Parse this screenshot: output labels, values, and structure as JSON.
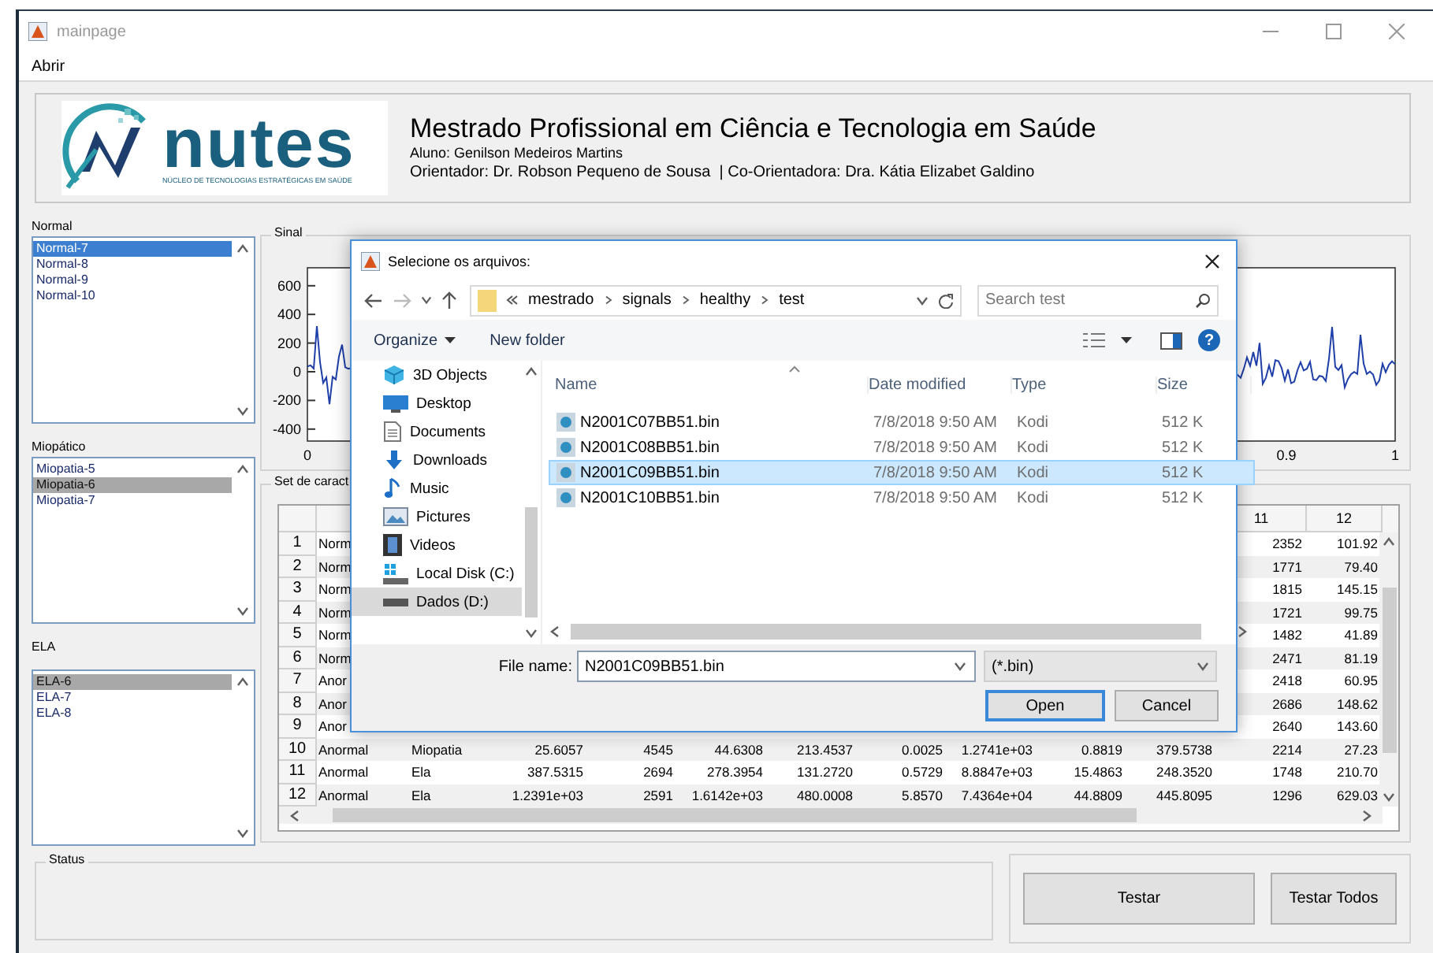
{
  "window": {
    "title": "mainpage"
  },
  "menu": [
    "Abrir"
  ],
  "header": {
    "logo": {
      "wordmark": "nutes",
      "tagline": "NÚCLEO DE TECNOLOGIAS ESTRATÉGICAS EM SAÚDE"
    },
    "title": "Mestrado Profissional em Ciência e Tecnologia em Saúde",
    "student": "Aluno: Genilson Medeiros Martins",
    "advisors": "Orientador: Dr. Robson Pequeno de Sousa  | Co-Orientadora: Dra. Kátia Elizabet Galdino"
  },
  "lists": [
    {
      "label": "Normal",
      "focused": true,
      "items": [
        {
          "text": "Normal-7",
          "selected": true
        },
        {
          "text": "Normal-8",
          "selected": false
        },
        {
          "text": "Normal-9",
          "selected": false
        },
        {
          "text": "Normal-10",
          "selected": false
        }
      ]
    },
    {
      "label": "Miopático",
      "focused": false,
      "items": [
        {
          "text": "Miopatia-5",
          "selected": false
        },
        {
          "text": "Miopatia-6",
          "selected": true
        },
        {
          "text": "Miopatia-7",
          "selected": false
        }
      ]
    },
    {
      "label": "ELA",
      "focused": false,
      "items": [
        {
          "text": "ELA-6",
          "selected": true
        },
        {
          "text": "ELA-7",
          "selected": false
        },
        {
          "text": "ELA-8",
          "selected": false
        }
      ]
    }
  ],
  "signal_panel": {
    "title": "Sinal",
    "y_ticks": [
      "600",
      "400",
      "200",
      "0",
      "-200",
      "-400"
    ],
    "x_ticks": [
      "0",
      "0.9",
      "1"
    ]
  },
  "features_panel": {
    "title": "Set de caract",
    "columns": [
      "11",
      "12"
    ],
    "rows": [
      {
        "number": "1",
        "group": "Norm",
        "col_11": "2352",
        "col_12": "101.92"
      },
      {
        "number": "2",
        "group": "Norm",
        "col_11": "1771",
        "col_12": "79.40"
      },
      {
        "number": "3",
        "group": "Norm",
        "col_11": "1815",
        "col_12": "145.15"
      },
      {
        "number": "4",
        "group": "Norm",
        "col_11": "1721",
        "col_12": "99.75"
      },
      {
        "number": "5",
        "group": "Norm",
        "col_11": "1482",
        "col_12": "41.89"
      },
      {
        "number": "6",
        "group": "Norm",
        "col_11": "2471",
        "col_12": "81.19"
      },
      {
        "number": "7",
        "group": "Anor",
        "col_11": "2418",
        "col_12": "60.95"
      },
      {
        "number": "8",
        "group": "Anor",
        "col_11": "2686",
        "col_12": "148.62"
      },
      {
        "number": "9",
        "group": "Anor",
        "col_11": "2640",
        "col_12": "143.60"
      },
      {
        "number": "10",
        "group": "Anormal",
        "values": [
          "Miopatia",
          "25.6057",
          "4545",
          "44.6308",
          "213.4537",
          "0.0025",
          "1.2741e+03",
          "0.8819",
          "379.5738"
        ],
        "col_11": "2214",
        "col_12": "27.23"
      },
      {
        "number": "11",
        "group": "Anormal",
        "values": [
          "Ela",
          "387.5315",
          "2694",
          "278.3954",
          "131.2720",
          "0.5729",
          "8.8847e+03",
          "15.4863",
          "248.3520"
        ],
        "col_11": "1748",
        "col_12": "210.70"
      },
      {
        "number": "12",
        "group": "Anormal",
        "values": [
          "Ela",
          "1.2391e+03",
          "2591",
          "1.6142e+03",
          "480.0008",
          "5.8570",
          "7.4364e+04",
          "44.8809",
          "445.8095"
        ],
        "col_11": "1296",
        "col_12": "629.03"
      }
    ]
  },
  "status_panel": {
    "title": "Status"
  },
  "buttons": [
    {
      "label": "Testar"
    },
    {
      "label": "Testar Todos"
    }
  ],
  "dialog": {
    "title": "Selecione os arquivos:",
    "path": [
      "mestrado",
      "signals",
      "healthy",
      "test"
    ],
    "search": {
      "placeholder": "Search test"
    },
    "toolbar": [
      "Organize",
      "New folder"
    ],
    "help": "?",
    "nav": [
      {
        "text": "3D Objects",
        "kind": "objects",
        "selected": false
      },
      {
        "text": "Desktop",
        "kind": "desktop",
        "selected": false
      },
      {
        "text": "Documents",
        "kind": "documents",
        "selected": false
      },
      {
        "text": "Downloads",
        "kind": "downloads",
        "selected": false
      },
      {
        "text": "Music",
        "kind": "music",
        "selected": false
      },
      {
        "text": "Pictures",
        "kind": "pictures",
        "selected": false
      },
      {
        "text": "Videos",
        "kind": "videos",
        "selected": false
      },
      {
        "text": "Local Disk (C:)",
        "kind": "disk",
        "selected": false
      },
      {
        "text": "Dados (D:)",
        "kind": "drive",
        "selected": true
      }
    ],
    "columns": [
      "Name",
      "Date modified",
      "Type",
      "Size"
    ],
    "files": [
      {
        "name": "N2001C07BB51.bin",
        "date": "7/8/2018 9:50 AM",
        "type": "Kodi",
        "size": "512 K",
        "selected": false
      },
      {
        "name": "N2001C08BB51.bin",
        "date": "7/8/2018 9:50 AM",
        "type": "Kodi",
        "size": "512 K",
        "selected": false
      },
      {
        "name": "N2001C09BB51.bin",
        "date": "7/8/2018 9:50 AM",
        "type": "Kodi",
        "size": "512 K",
        "selected": true
      },
      {
        "name": "N2001C10BB51.bin",
        "date": "7/8/2018 9:50 AM",
        "type": "Kodi",
        "size": "512 K",
        "selected": false
      }
    ],
    "file_name_label": "File name:",
    "file_name": "N2001C09BB51.bin",
    "filter": "(*.bin)",
    "buttons": [
      {
        "label": "Open",
        "default": true
      },
      {
        "label": "Cancel",
        "default": false
      }
    ]
  }
}
